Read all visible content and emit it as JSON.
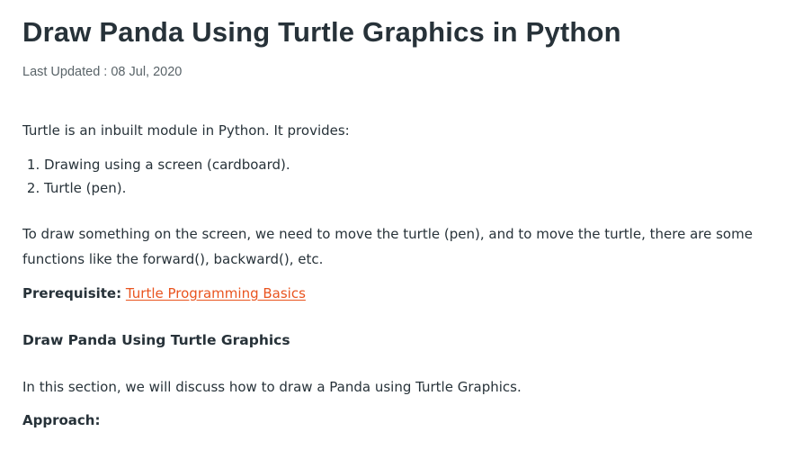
{
  "article": {
    "title": "Draw Panda Using Turtle Graphics in Python",
    "last_updated": "Last Updated : 08 Jul, 2020",
    "intro": "Turtle is an inbuilt module in Python. It provides:",
    "provides_list": [
      "Drawing using a screen (cardboard).",
      "Turtle (pen)."
    ],
    "move_text": "To draw something on the screen, we need to move the turtle (pen), and to move the turtle, there are some functions like the forward(), backward(), etc.",
    "prerequisite_label": "Prerequisite:",
    "prerequisite_link_text": "Turtle Programming Basics",
    "section_heading": "Draw Panda Using Turtle Graphics",
    "section_intro": "In this section, we will discuss how to draw a Panda using Turtle Graphics.",
    "approach_label": "Approach:"
  },
  "colors": {
    "text": "#273239",
    "meta": "#5a6469",
    "link": "#e9541f"
  }
}
